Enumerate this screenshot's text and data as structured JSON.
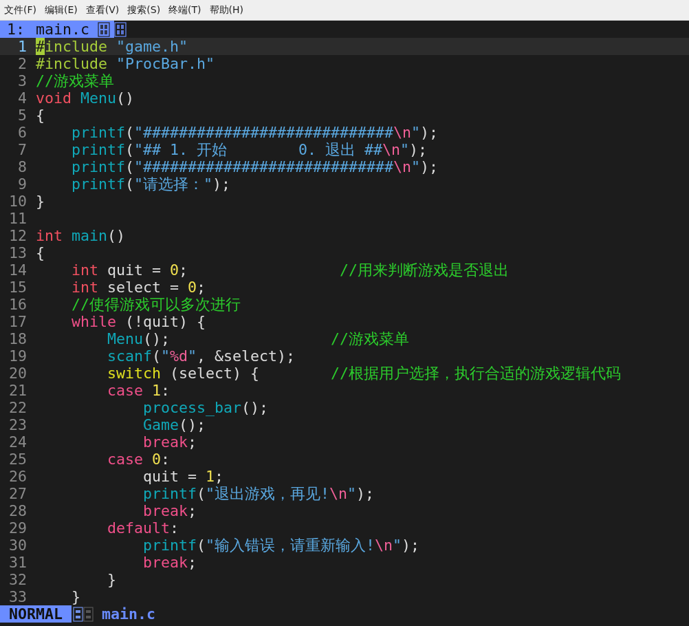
{
  "menu_bar": [
    {
      "label": "文件(F)"
    },
    {
      "label": "编辑(E)"
    },
    {
      "label": "查看(V)"
    },
    {
      "label": "搜索(S)"
    },
    {
      "label": "终端(T)"
    },
    {
      "label": "帮助(H)"
    }
  ],
  "tab_line": {
    "tabs": [
      {
        "number": "1:",
        "label": "main.c",
        "selected": true
      }
    ]
  },
  "code_lines": [
    {
      "number": "1",
      "current": true,
      "tokens": [
        {
          "kind": "cursor",
          "text": "#"
        },
        {
          "kind": "pre",
          "text": "include"
        },
        {
          "kind": "str",
          "text": " \"game.h\""
        }
      ]
    },
    {
      "number": "2",
      "current": false,
      "tokens": [
        {
          "kind": "pre",
          "text": "#include"
        },
        {
          "kind": "str",
          "text": " \"ProcBar.h\""
        }
      ]
    },
    {
      "number": "3",
      "current": false,
      "tokens": [
        {
          "kind": "com",
          "text": "//游戏菜单"
        }
      ]
    },
    {
      "number": "4",
      "current": false,
      "tokens": [
        {
          "kind": "kw",
          "text": "void"
        },
        {
          "kind": "fn",
          "text": " Menu"
        },
        {
          "kind": "txt",
          "text": "()"
        }
      ]
    },
    {
      "number": "5",
      "current": false,
      "tokens": [
        {
          "kind": "txt",
          "text": "{"
        }
      ]
    },
    {
      "number": "6",
      "current": false,
      "tokens": [
        {
          "kind": "fn",
          "text": "    printf"
        },
        {
          "kind": "txt",
          "text": "("
        },
        {
          "kind": "str",
          "text": "\"############################"
        },
        {
          "kind": "esc",
          "text": "\\n"
        },
        {
          "kind": "str",
          "text": "\""
        },
        {
          "kind": "txt",
          "text": ");"
        }
      ]
    },
    {
      "number": "7",
      "current": false,
      "tokens": [
        {
          "kind": "fn",
          "text": "    printf"
        },
        {
          "kind": "txt",
          "text": "("
        },
        {
          "kind": "str",
          "text": "\"## 1. 开始        0. 退出 ##"
        },
        {
          "kind": "esc",
          "text": "\\n"
        },
        {
          "kind": "str",
          "text": "\""
        },
        {
          "kind": "txt",
          "text": ");"
        }
      ]
    },
    {
      "number": "8",
      "current": false,
      "tokens": [
        {
          "kind": "fn",
          "text": "    printf"
        },
        {
          "kind": "txt",
          "text": "("
        },
        {
          "kind": "str",
          "text": "\"############################"
        },
        {
          "kind": "esc",
          "text": "\\n"
        },
        {
          "kind": "str",
          "text": "\""
        },
        {
          "kind": "txt",
          "text": ");"
        }
      ]
    },
    {
      "number": "9",
      "current": false,
      "tokens": [
        {
          "kind": "fn",
          "text": "    printf"
        },
        {
          "kind": "txt",
          "text": "("
        },
        {
          "kind": "str",
          "text": "\"请选择：\""
        },
        {
          "kind": "txt",
          "text": ");"
        }
      ]
    },
    {
      "number": "10",
      "current": false,
      "tokens": [
        {
          "kind": "txt",
          "text": "}"
        }
      ]
    },
    {
      "number": "11",
      "current": false
    },
    {
      "number": "12",
      "current": false,
      "tokens": [
        {
          "kind": "kw",
          "text": "int"
        },
        {
          "kind": "fn",
          "text": " main"
        },
        {
          "kind": "txt",
          "text": "()"
        }
      ]
    },
    {
      "number": "13",
      "current": false,
      "tokens": [
        {
          "kind": "txt",
          "text": "{"
        }
      ]
    },
    {
      "number": "14",
      "current": false,
      "tokens": [
        {
          "kind": "kw",
          "text": "    int"
        },
        {
          "kind": "txt",
          "text": " quit = "
        },
        {
          "kind": "num",
          "text": "0"
        },
        {
          "kind": "txt",
          "text": ";                 "
        },
        {
          "kind": "com",
          "text": "//用来判断游戏是否退出"
        }
      ]
    },
    {
      "number": "15",
      "current": false,
      "tokens": [
        {
          "kind": "kw",
          "text": "    int"
        },
        {
          "kind": "txt",
          "text": " select = "
        },
        {
          "kind": "num",
          "text": "0"
        },
        {
          "kind": "txt",
          "text": ";"
        }
      ]
    },
    {
      "number": "16",
      "current": false,
      "tokens": [
        {
          "kind": "com",
          "text": "    //使得游戏可以多次进行"
        }
      ]
    },
    {
      "number": "17",
      "current": false,
      "tokens": [
        {
          "kind": "ctl",
          "text": "    while"
        },
        {
          "kind": "txt",
          "text": " (!quit) {"
        }
      ]
    },
    {
      "number": "18",
      "current": false,
      "tokens": [
        {
          "kind": "fn",
          "text": "        Menu"
        },
        {
          "kind": "txt",
          "text": "();                  "
        },
        {
          "kind": "com",
          "text": "//游戏菜单"
        }
      ]
    },
    {
      "number": "19",
      "current": false,
      "tokens": [
        {
          "kind": "fn",
          "text": "        scanf"
        },
        {
          "kind": "txt",
          "text": "("
        },
        {
          "kind": "str",
          "text": "\""
        },
        {
          "kind": "esc",
          "text": "%d"
        },
        {
          "kind": "str",
          "text": "\""
        },
        {
          "kind": "txt",
          "text": ", &select);"
        }
      ]
    },
    {
      "number": "20",
      "current": false,
      "tokens": [
        {
          "kind": "sw",
          "text": "        switch"
        },
        {
          "kind": "txt",
          "text": " (select) {        "
        },
        {
          "kind": "com",
          "text": "//根据用户选择，执行合适的游戏逻辑代码"
        }
      ]
    },
    {
      "number": "21",
      "current": false,
      "tokens": [
        {
          "kind": "ctl",
          "text": "        case"
        },
        {
          "kind": "num",
          "text": " 1"
        },
        {
          "kind": "txt",
          "text": ":"
        }
      ]
    },
    {
      "number": "22",
      "current": false,
      "tokens": [
        {
          "kind": "fn",
          "text": "            process_bar"
        },
        {
          "kind": "txt",
          "text": "();"
        }
      ]
    },
    {
      "number": "23",
      "current": false,
      "tokens": [
        {
          "kind": "fn",
          "text": "            Game"
        },
        {
          "kind": "txt",
          "text": "();"
        }
      ]
    },
    {
      "number": "24",
      "current": false,
      "tokens": [
        {
          "kind": "ctl",
          "text": "            break"
        },
        {
          "kind": "txt",
          "text": ";"
        }
      ]
    },
    {
      "number": "25",
      "current": false,
      "tokens": [
        {
          "kind": "ctl",
          "text": "        case"
        },
        {
          "kind": "num",
          "text": " 0"
        },
        {
          "kind": "txt",
          "text": ":"
        }
      ]
    },
    {
      "number": "26",
      "current": false,
      "tokens": [
        {
          "kind": "txt",
          "text": "            quit = "
        },
        {
          "kind": "num",
          "text": "1"
        },
        {
          "kind": "txt",
          "text": ";"
        }
      ]
    },
    {
      "number": "27",
      "current": false,
      "tokens": [
        {
          "kind": "fn",
          "text": "            printf"
        },
        {
          "kind": "txt",
          "text": "("
        },
        {
          "kind": "str",
          "text": "\"退出游戏，再见!"
        },
        {
          "kind": "esc",
          "text": "\\n"
        },
        {
          "kind": "str",
          "text": "\""
        },
        {
          "kind": "txt",
          "text": ");"
        }
      ]
    },
    {
      "number": "28",
      "current": false,
      "tokens": [
        {
          "kind": "ctl",
          "text": "            break"
        },
        {
          "kind": "txt",
          "text": ";"
        }
      ]
    },
    {
      "number": "29",
      "current": false,
      "tokens": [
        {
          "kind": "ctl",
          "text": "        default"
        },
        {
          "kind": "txt",
          "text": ":"
        }
      ]
    },
    {
      "number": "30",
      "current": false,
      "tokens": [
        {
          "kind": "fn",
          "text": "            printf"
        },
        {
          "kind": "txt",
          "text": "("
        },
        {
          "kind": "str",
          "text": "\"输入错误，请重新输入!"
        },
        {
          "kind": "esc",
          "text": "\\n"
        },
        {
          "kind": "str",
          "text": "\""
        },
        {
          "kind": "txt",
          "text": ");"
        }
      ]
    },
    {
      "number": "31",
      "current": false,
      "tokens": [
        {
          "kind": "ctl",
          "text": "            break"
        },
        {
          "kind": "txt",
          "text": ";"
        }
      ]
    },
    {
      "number": "32",
      "current": false,
      "tokens": [
        {
          "kind": "txt",
          "text": "        }"
        }
      ]
    },
    {
      "number": "33",
      "current": false,
      "tokens": [
        {
          "kind": "txt",
          "text": "    }"
        }
      ]
    }
  ],
  "status_line": {
    "mode": "NORMAL",
    "file": "main.c"
  }
}
